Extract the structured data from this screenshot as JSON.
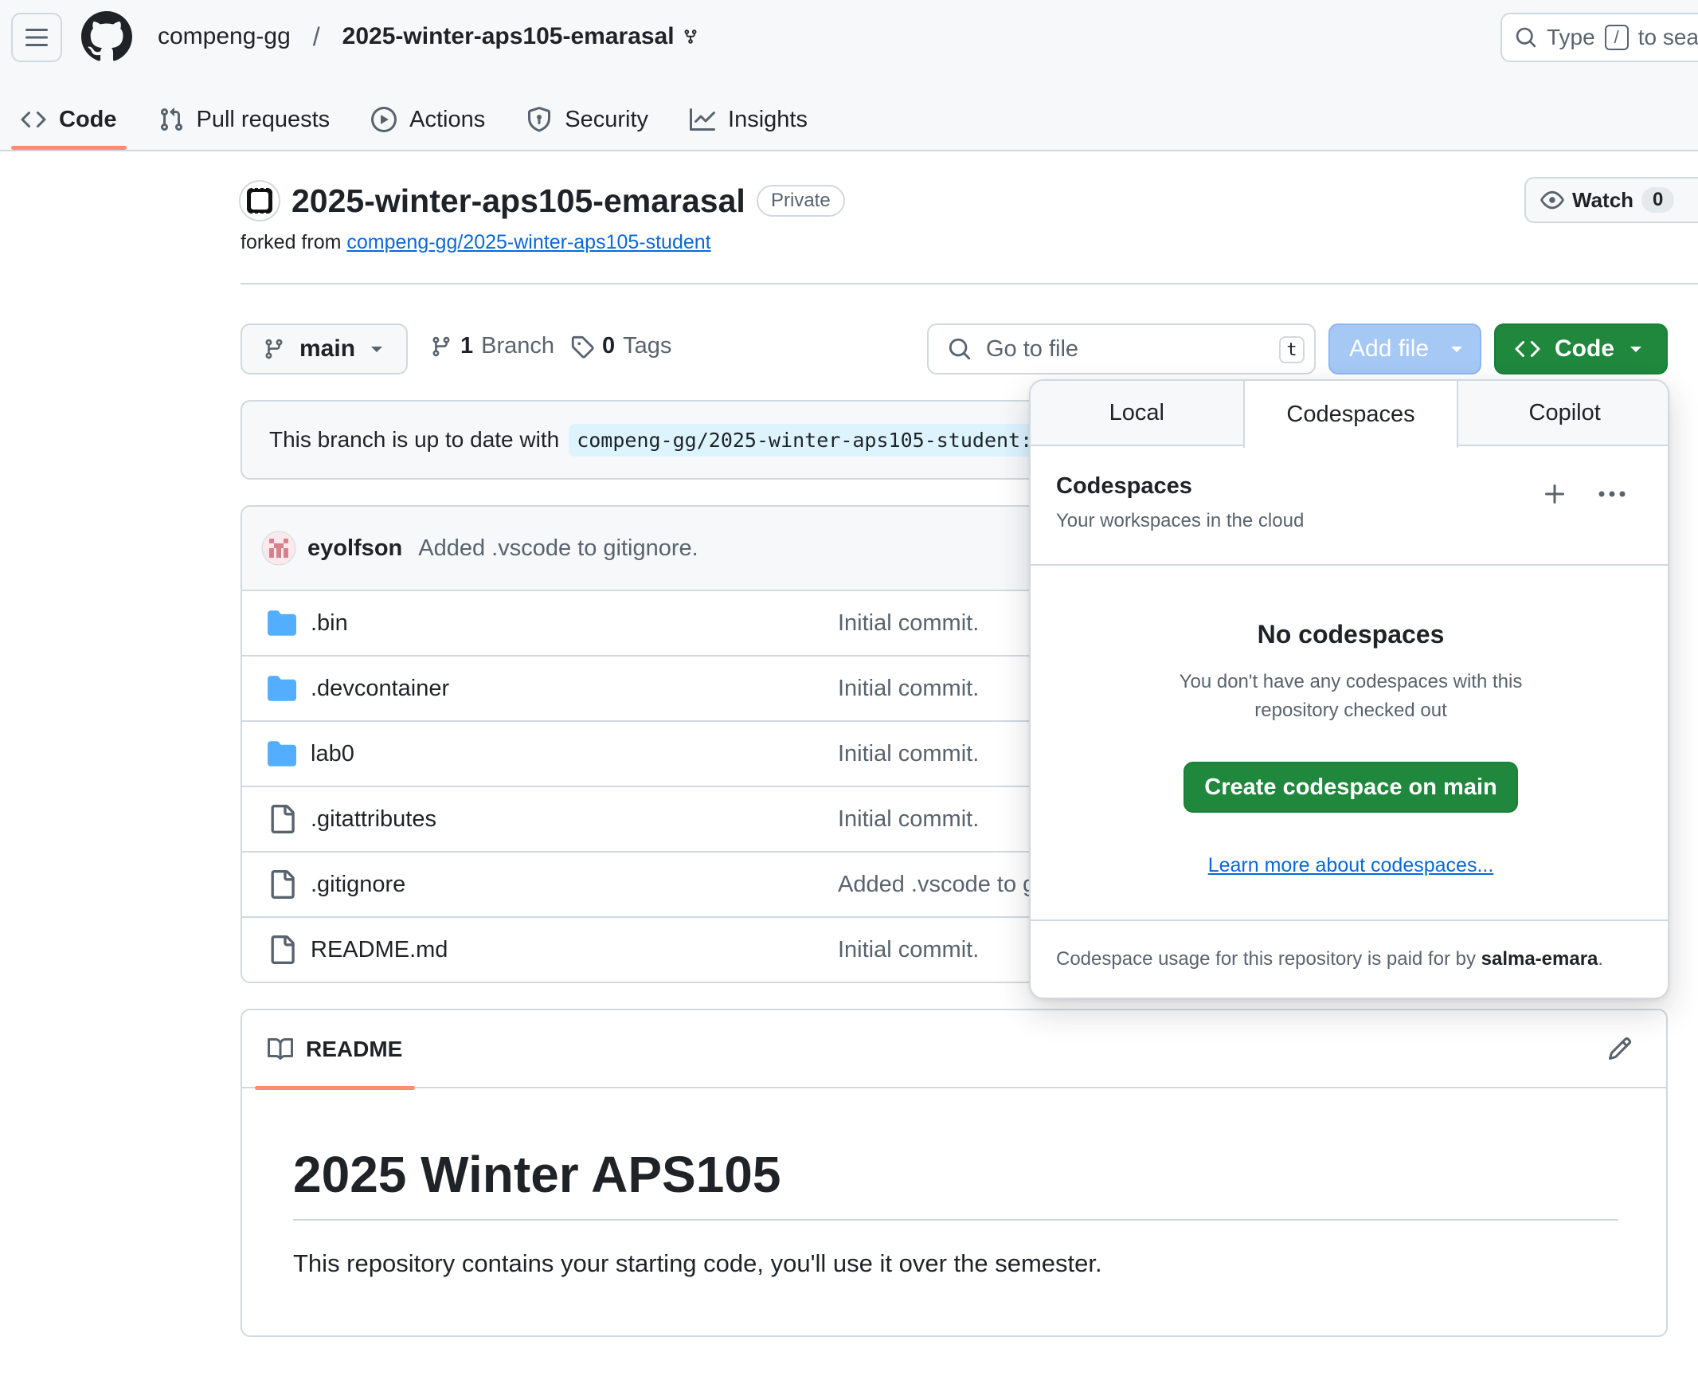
{
  "header": {
    "owner": "compeng-gg",
    "separator": "/",
    "repo": "2025-winter-aps105-emarasal",
    "search_prefix": "Type",
    "search_key": "/",
    "search_suffix": "to sea"
  },
  "nav": {
    "tabs": [
      {
        "label": "Code",
        "icon": "code-icon",
        "active": true
      },
      {
        "label": "Pull requests",
        "icon": "pull-request-icon"
      },
      {
        "label": "Actions",
        "icon": "play-icon"
      },
      {
        "label": "Security",
        "icon": "shield-icon"
      },
      {
        "label": "Insights",
        "icon": "graph-icon"
      }
    ]
  },
  "repo": {
    "title": "2025-winter-aps105-emarasal",
    "visibility": "Private",
    "forked_prefix": "forked from",
    "forked_from": "compeng-gg/2025-winter-aps105-student",
    "watch_label": "Watch",
    "watch_count": "0"
  },
  "toolbar": {
    "branch": "main",
    "branch_count": "1",
    "branch_word": "Branch",
    "tag_count": "0",
    "tag_word": "Tags",
    "goto_placeholder": "Go to file",
    "goto_key": "t",
    "add_file": "Add file",
    "code": "Code"
  },
  "branch_info": {
    "text": "This branch is up to date with",
    "ref": "compeng-gg/2025-winter-aps105-student:"
  },
  "commit": {
    "author": "eyolfson",
    "message": "Added .vscode to gitignore."
  },
  "files": [
    {
      "name": ".bin",
      "type": "folder",
      "message": "Initial commit."
    },
    {
      "name": ".devcontainer",
      "type": "folder",
      "message": "Initial commit."
    },
    {
      "name": "lab0",
      "type": "folder",
      "message": "Initial commit."
    },
    {
      "name": ".gitattributes",
      "type": "file",
      "message": "Initial commit."
    },
    {
      "name": ".gitignore",
      "type": "file",
      "message": "Added .vscode to g"
    },
    {
      "name": "README.md",
      "type": "file",
      "message": "Initial commit."
    }
  ],
  "readme": {
    "tab": "README",
    "heading": "2025 Winter APS105",
    "paragraph": "This repository contains your starting code, you'll use it over the semester."
  },
  "popover": {
    "tabs": [
      "Local",
      "Codespaces",
      "Copilot"
    ],
    "active_tab": "Codespaces",
    "title": "Codespaces",
    "subtitle": "Your workspaces in the cloud",
    "empty_title": "No codespaces",
    "empty_text": "You don't have any codespaces with this repository checked out",
    "create_button": "Create codespace on main",
    "learn_more": "Learn more about codespaces...",
    "footer_prefix": "Codespace usage for this repository is paid for by",
    "footer_user": "salma-emara",
    "footer_suffix": "."
  },
  "colors": {
    "primary_green": "#1f883d",
    "link_blue": "#0969da",
    "active_underline": "#fd8c73",
    "folder_blue": "#54aeff",
    "add_file_disabled": "#a5c8f5"
  }
}
